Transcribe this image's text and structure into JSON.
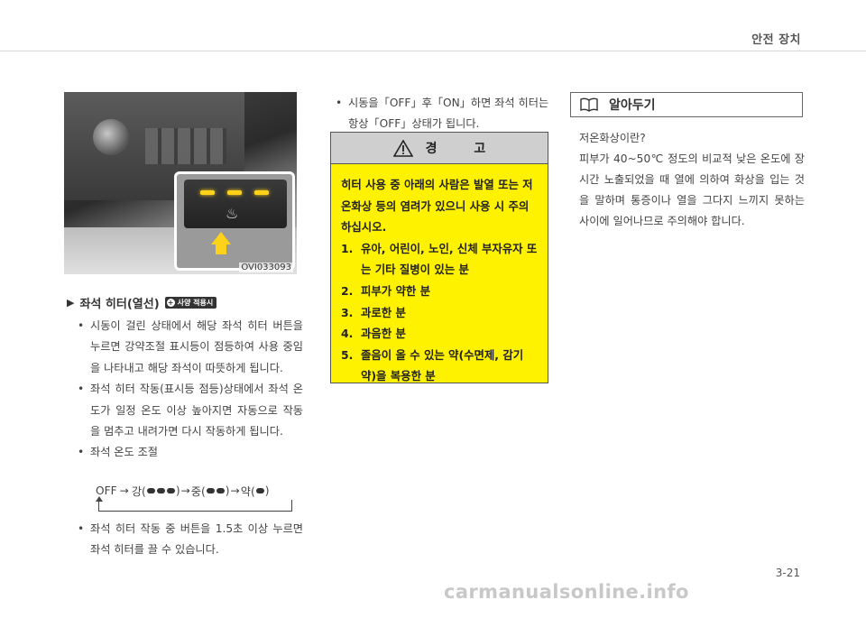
{
  "header": {
    "title": "안전 장치"
  },
  "photo": {
    "code": "OVI033093"
  },
  "section": {
    "heading": "좌석 히터(열선)",
    "badge": "사양 적용시",
    "bullets": [
      "시동이 걸린 상태에서 해당 좌석 히터 버튼을 누르면 강약조절 표시등이 점등하여 사용 중임을 나타내고 해당 좌석이 따뜻하게 됩니다.",
      "좌석 히터 작동(표시등 점등)상태에서 좌석 온도가 일정 온도 이상 높아지면 자동으로 작동을 멈추고 내려가면 다시 작동하게 됩니다.",
      "좌석 온도 조절"
    ],
    "sequence": {
      "off": "OFF",
      "arrow": "→",
      "high": "강(",
      "mid": "중(",
      "low": "약(",
      "close": ")"
    },
    "bullets_after": [
      "좌석 히터 작동 중 버튼을 1.5초 이상 누르면 좌석 히터를 끌 수 있습니다."
    ]
  },
  "col2": {
    "note": "시동을「OFF」후「ON」하면 좌석 히터는 항상「OFF」상태가 됩니다.",
    "warning": {
      "title": "경 고",
      "intro": "히터 사용 중 아래의 사람은 발열 또는 저온화상 등의 염려가 있으니 사용 시 주의하십시오.",
      "items": [
        {
          "num": "1.",
          "text": "유아, 어린이, 노인, 신체 부자유자 또는 기타 질병이 있는 분"
        },
        {
          "num": "2.",
          "text": "피부가 약한 분"
        },
        {
          "num": "3.",
          "text": "과로한 분"
        },
        {
          "num": "4.",
          "text": "과음한 분"
        },
        {
          "num": "5.",
          "text": "졸음이 올 수 있는 약(수면제, 감기약)을 복용한 분"
        }
      ]
    }
  },
  "col3": {
    "title": "알아두기",
    "question": "저온화상이란?",
    "body": "피부가 40~50℃ 정도의 비교적 낮은 온도에 장시간 노출되었을 때 열에 의하여 화상을 입는 것을 말하며 통증이나 열을 그다지 느끼지 못하는 사이에 일어나므로 주의해야 합니다."
  },
  "footer": {
    "page": "3-21",
    "watermark": "carmanualsonline.info"
  },
  "colors": {
    "warning_bg": "#fff200",
    "warning_head": "#cfcfcf",
    "led": "#ffd21a"
  }
}
